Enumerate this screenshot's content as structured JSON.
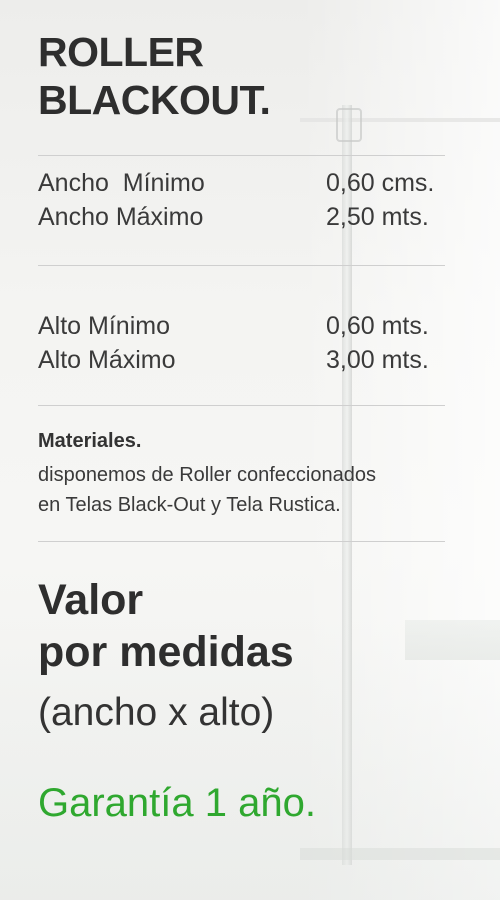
{
  "title": [
    "ROLLER",
    "BLACKOUT."
  ],
  "ancho": [
    {
      "label": "Ancho  Mínimo",
      "value": "0,60 cms."
    },
    {
      "label": "Ancho Máximo",
      "value": "2,50 mts."
    }
  ],
  "alto": [
    {
      "label": "Alto Mínimo",
      "value": "0,60 mts."
    },
    {
      "label": "Alto Máximo",
      "value": "3,00 mts."
    }
  ],
  "materiales": {
    "title": "Materiales.",
    "lines": [
      "disponemos de Roller confeccionados",
      "en Telas Black-Out y Tela Rustica."
    ]
  },
  "valor": [
    "Valor",
    "por medidas"
  ],
  "medidas_note": "(ancho x alto)",
  "garantia": "Garantía 1 año.",
  "colors": {
    "text": "#2e2e2e",
    "accent": "#2fa82f",
    "rule": "#cfcfcf"
  }
}
